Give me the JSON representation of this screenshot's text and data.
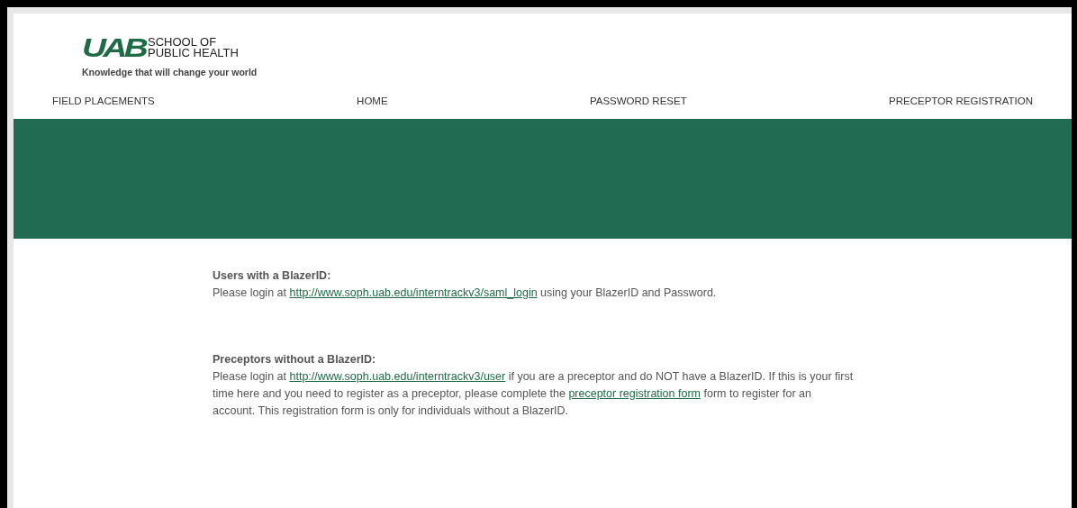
{
  "logo": {
    "mark": "UAB",
    "name_lines": [
      "SCHOOL OF",
      "PUBLIC HEALTH"
    ],
    "tagline": "Knowledge that will change your world"
  },
  "nav": [
    {
      "label": "FIELD PLACEMENTS"
    },
    {
      "label": "HOME"
    },
    {
      "label": "PASSWORD RESET"
    },
    {
      "label": "PRECEPTOR REGISTRATION"
    }
  ],
  "sections": [
    {
      "heading": "Users with a BlazerID:",
      "segments": [
        {
          "kind": "text",
          "text": "Please login at "
        },
        {
          "kind": "link",
          "text": "http://www.soph.uab.edu/interntrackv3/saml_login"
        },
        {
          "kind": "text",
          "text": " using your BlazerID and Password."
        }
      ]
    },
    {
      "heading": "Preceptors without a BlazerID:",
      "segments": [
        {
          "kind": "text",
          "text": "Please login at "
        },
        {
          "kind": "link",
          "text": "http://www.soph.uab.edu/interntrackv3/user"
        },
        {
          "kind": "text",
          "text": " if you are a preceptor and do NOT have a BlazerID. If this is your first time here and you need to register as a preceptor, please complete the "
        },
        {
          "kind": "link",
          "text": "preceptor registration form"
        },
        {
          "kind": "text",
          "text": " form to register for an account. This registration form is only for individuals without a BlazerID."
        }
      ]
    }
  ]
}
